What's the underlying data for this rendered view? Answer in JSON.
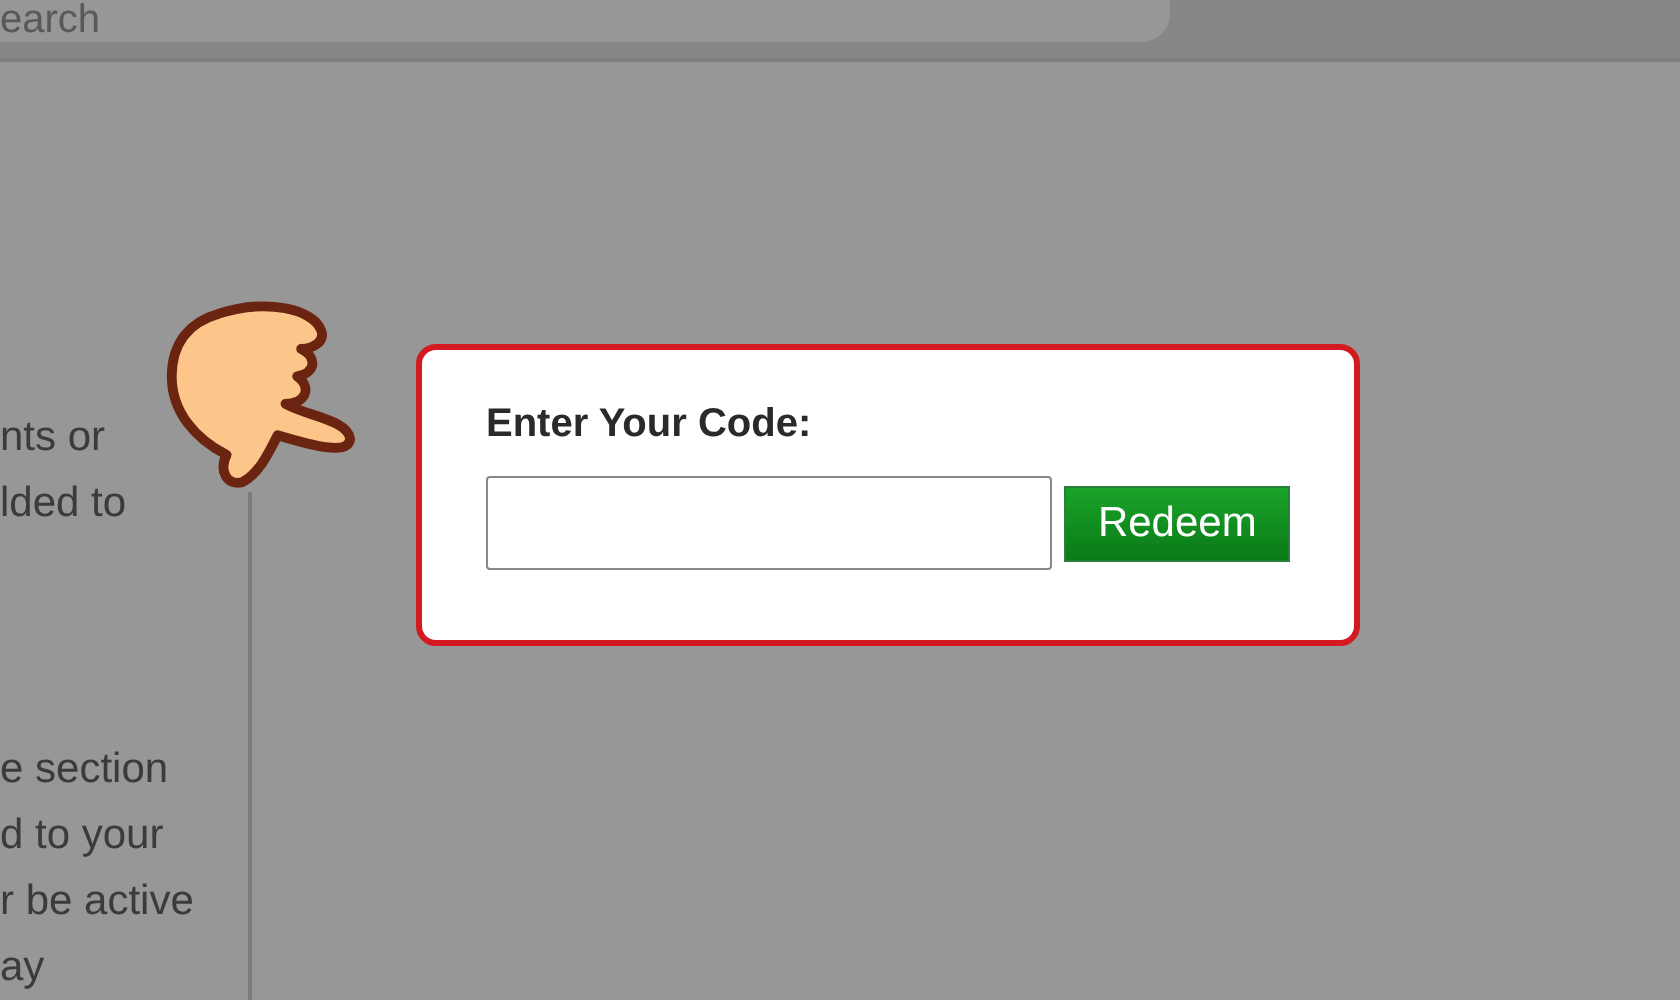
{
  "header": {
    "search": {
      "placeholder": "earch"
    }
  },
  "side_text": [
    {
      "lines": [
        "nts or",
        "lded to"
      ]
    },
    {
      "lines": [
        "e section",
        "d to your",
        "r be active",
        "ay"
      ]
    }
  ],
  "redeem_card": {
    "label": "Enter Your Code:",
    "button": "Redeem"
  }
}
